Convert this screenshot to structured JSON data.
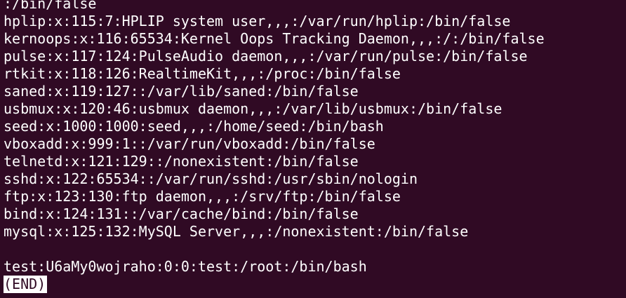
{
  "terminal": {
    "lines": [
      ":/bin/false",
      "hplip:x:115:7:HPLIP system user,,,:/var/run/hplip:/bin/false",
      "kernoops:x:116:65534:Kernel Oops Tracking Daemon,,,:/:/bin/false",
      "pulse:x:117:124:PulseAudio daemon,,,:/var/run/pulse:/bin/false",
      "rtkit:x:118:126:RealtimeKit,,,:/proc:/bin/false",
      "saned:x:119:127::/var/lib/saned:/bin/false",
      "usbmux:x:120:46:usbmux daemon,,,:/var/lib/usbmux:/bin/false",
      "seed:x:1000:1000:seed,,,:/home/seed:/bin/bash",
      "vboxadd:x:999:1::/var/run/vboxadd:/bin/false",
      "telnetd:x:121:129::/nonexistent:/bin/false",
      "sshd:x:122:65534::/var/run/sshd:/usr/sbin/nologin",
      "ftp:x:123:130:ftp daemon,,,:/srv/ftp:/bin/false",
      "bind:x:124:131::/var/cache/bind:/bin/false",
      "mysql:x:125:132:MySQL Server,,,:/nonexistent:/bin/false",
      "",
      "test:U6aMy0wojraho:0:0:test:/root:/bin/bash"
    ],
    "end_marker": "(END)",
    "colors": {
      "background": "#300a24",
      "foreground": "#ffffff"
    }
  }
}
